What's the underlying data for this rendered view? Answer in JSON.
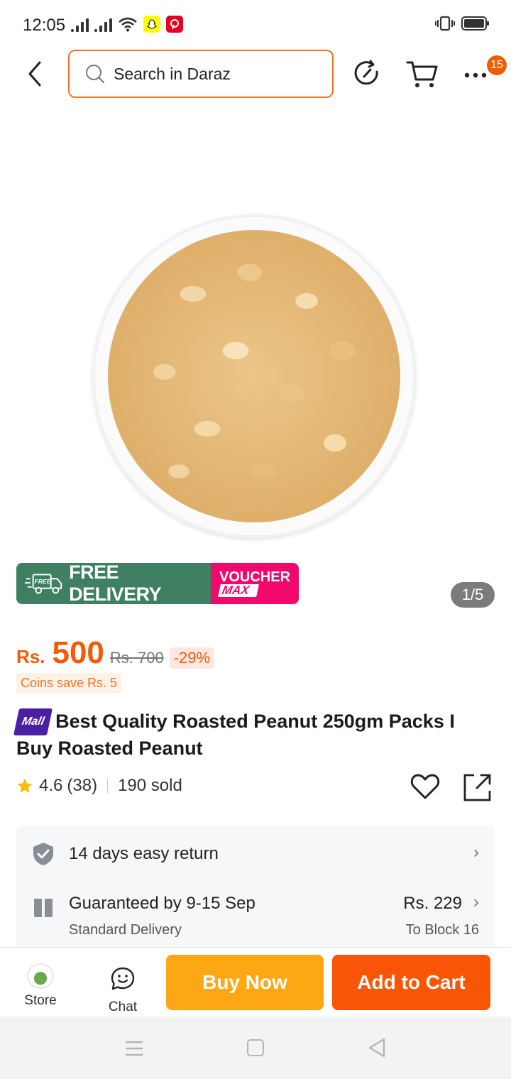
{
  "status_bar": {
    "time": "12:05"
  },
  "search": {
    "placeholder": "Search in Daraz"
  },
  "header": {
    "more_badge": "15"
  },
  "gallery": {
    "counter": "1/5"
  },
  "banner": {
    "free_delivery": "FREE DELIVERY",
    "free_tag": "FREE",
    "voucher_line1": "VOUCHER",
    "voucher_line2": "MAX"
  },
  "price": {
    "currency": "Rs.",
    "current": "500",
    "original": "Rs. 700",
    "discount": "-29%",
    "coins": "Coins save Rs. 5"
  },
  "product": {
    "mall_badge": "Mall",
    "title": "Best Quality Roasted Peanut 250gm Packs I Buy Roasted Peanut"
  },
  "rating": {
    "score": "4.6",
    "count": "(38)",
    "sold": "190 sold"
  },
  "services": {
    "return": "14 days easy return",
    "delivery_title": "Guaranteed by 9-15 Sep",
    "delivery_sub": "Standard Delivery",
    "delivery_price": "Rs. 229",
    "delivery_to": "To Block 16"
  },
  "bottom_bar": {
    "store": "Store",
    "chat": "Chat",
    "buy_now": "Buy Now",
    "add_to_cart": "Add to Cart"
  },
  "colors": {
    "accent": "#f35b04",
    "buy_now": "#fda714",
    "add_to_cart": "#f85606",
    "free_delivery_bg": "#3e8061",
    "voucher_bg": "#f0086b",
    "mall_badge": "#4a1fa3"
  }
}
